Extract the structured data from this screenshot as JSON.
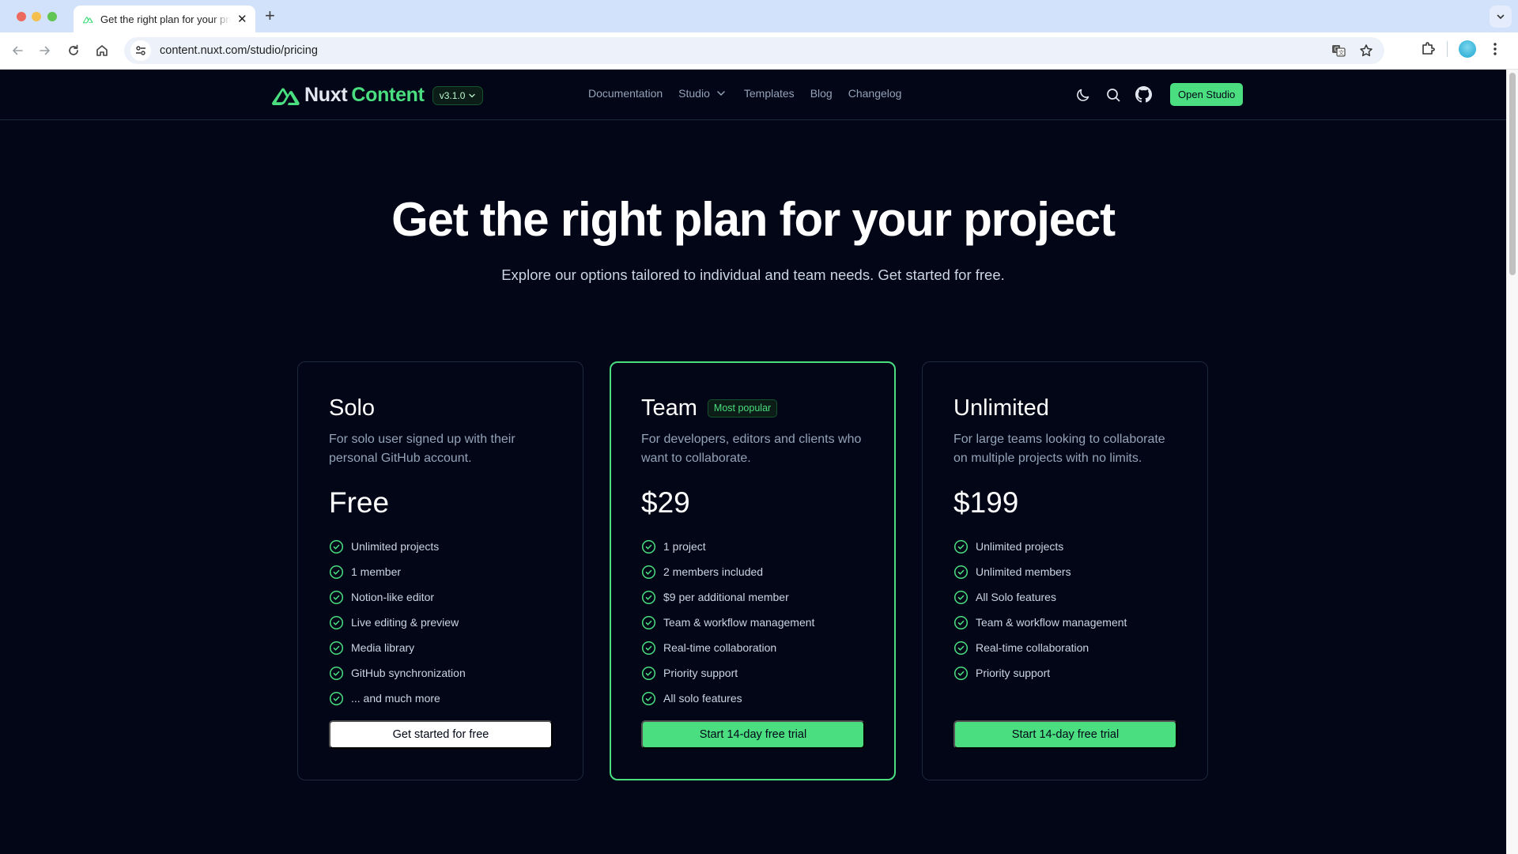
{
  "browser": {
    "tab_title": "Get the right plan for your project",
    "new_tab_label": "+",
    "close_tab_label": "✕",
    "url": "content.nuxt.com/studio/pricing"
  },
  "header": {
    "logo_word_1": "Nuxt",
    "logo_word_2": "Content",
    "version": "v3.1.0",
    "nav": [
      {
        "label": "Documentation"
      },
      {
        "label": "Studio",
        "has_dropdown": true
      },
      {
        "label": "Templates"
      },
      {
        "label": "Blog"
      },
      {
        "label": "Changelog"
      }
    ],
    "icons": [
      "moon-icon",
      "search-icon",
      "github-icon"
    ],
    "cta_label": "Open Studio"
  },
  "hero": {
    "title": "Get the right plan for your project",
    "subtitle": "Explore our options tailored to individual and team needs. Get started for free."
  },
  "colors": {
    "accent": "#4ade80",
    "background": "#020617",
    "muted_text": "#94a3b8"
  },
  "plans": [
    {
      "name": "Solo",
      "badge": null,
      "description": "For solo user signed up with their personal GitHub account.",
      "price": "Free",
      "features": [
        "Unlimited projects",
        "1 member",
        "Notion-like editor",
        "Live editing & preview",
        "Media library",
        "GitHub synchronization",
        "... and much more"
      ],
      "button_label": "Get started for free"
    },
    {
      "name": "Team",
      "badge": "Most popular",
      "description": "For developers, editors and clients who want to collaborate.",
      "price": "$29",
      "features": [
        "1 project",
        "2 members included",
        "$9 per additional member",
        "Team & workflow management",
        "Real-time collaboration",
        "Priority support",
        "All solo features"
      ],
      "button_label": "Start 14-day free trial"
    },
    {
      "name": "Unlimited",
      "badge": null,
      "description": "For large teams looking to collaborate on multiple projects with no limits.",
      "price": "$199",
      "features": [
        "Unlimited projects",
        "Unlimited members",
        "All Solo features",
        "Team & workflow management",
        "Real-time collaboration",
        "Priority support"
      ],
      "button_label": "Start 14-day free trial"
    }
  ]
}
